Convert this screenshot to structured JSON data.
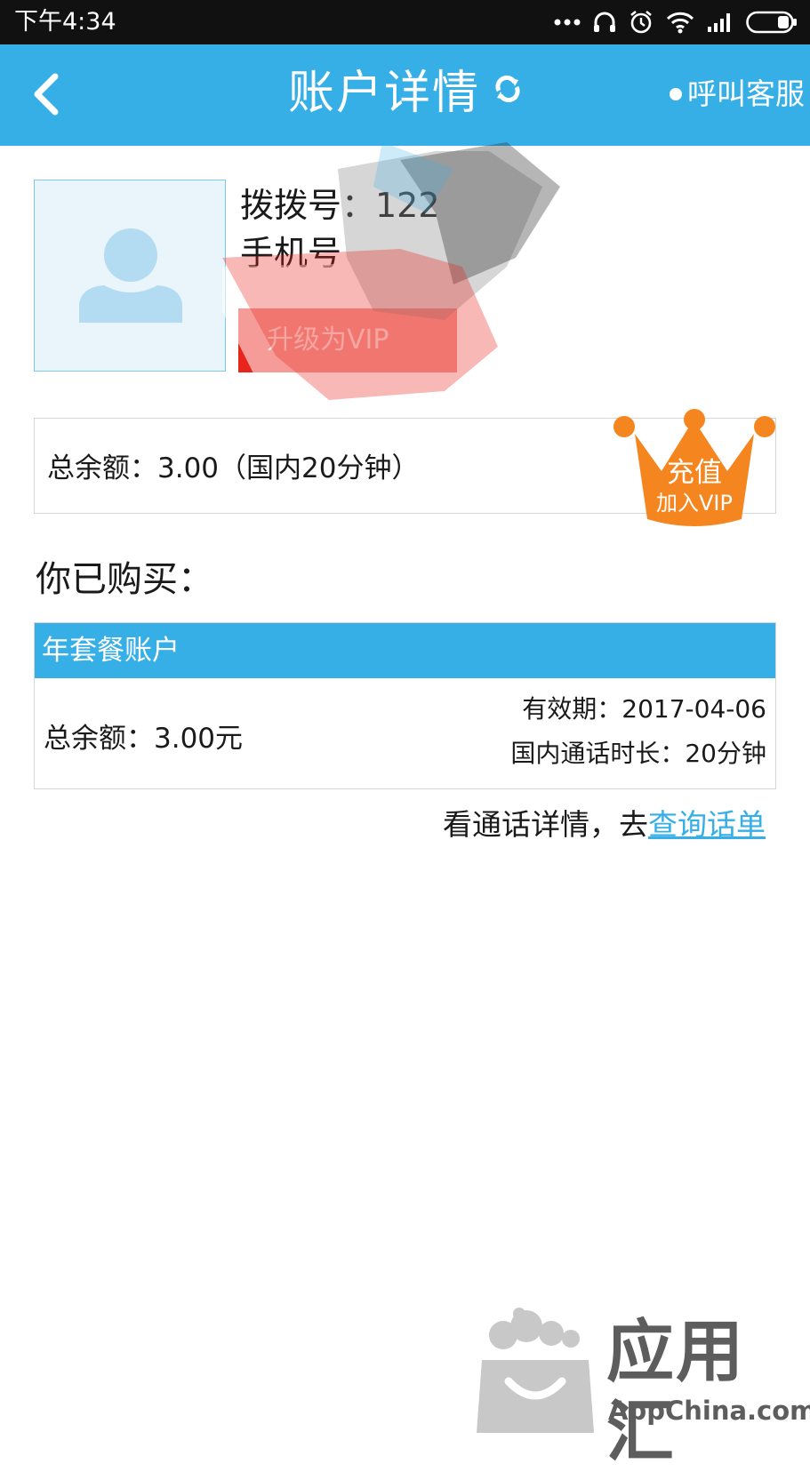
{
  "status_bar": {
    "time": "下午4:34",
    "icons": [
      "more-dots-icon",
      "headphones-icon",
      "alarm-icon",
      "wifi-icon",
      "signal-icon",
      "battery-icon"
    ]
  },
  "header": {
    "title": "账户详情",
    "call_service": "呼叫客服",
    "background": "#36aee6"
  },
  "profile": {
    "dial_label": "拨拨号：122",
    "phone_label": "手机号",
    "vip_button": "升级为VIP"
  },
  "balance": {
    "text": "总余额：3.00（国内20分钟）",
    "crown_line1": "充值",
    "crown_line2": "加入VIP",
    "crown_color": "#f5861f"
  },
  "purchased": {
    "heading": "你已购买：",
    "package": {
      "name": "年套餐账户",
      "balance": "总余额：3.00元",
      "valid_until": "有效期：2017-04-06",
      "domestic_duration": "国内通话时长：20分钟"
    }
  },
  "call_detail": {
    "prefix": "看通话详情，去",
    "link": "查询话单",
    "link_color": "#36aee6"
  },
  "watermark": {
    "cn": "应用汇",
    "en": "AppChina.com"
  }
}
